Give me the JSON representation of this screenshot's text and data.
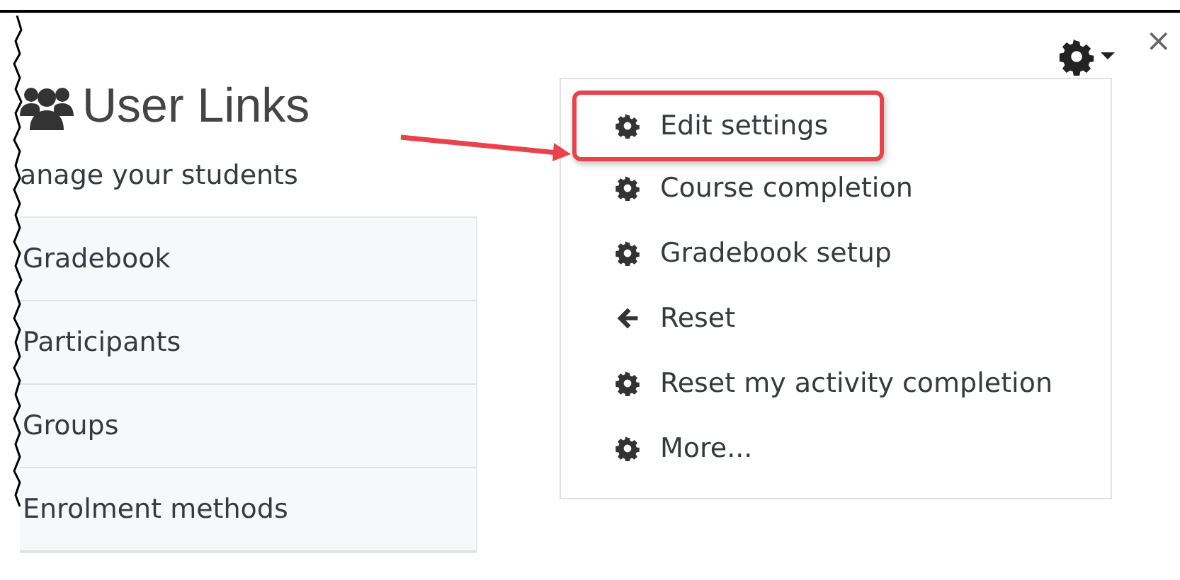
{
  "header": {
    "title": "User Links",
    "subtitle": "anage your students"
  },
  "close": "×",
  "links": [
    {
      "label": "Gradebook"
    },
    {
      "label": "Participants"
    },
    {
      "label": "Groups"
    },
    {
      "label": "Enrolment methods"
    }
  ],
  "menu": [
    {
      "label": "Edit settings",
      "kind": "gear",
      "highlighted": true
    },
    {
      "label": "Course completion",
      "kind": "gear",
      "highlighted": false
    },
    {
      "label": "Gradebook setup",
      "kind": "gear",
      "highlighted": false
    },
    {
      "label": "Reset",
      "kind": "back",
      "highlighted": false
    },
    {
      "label": "Reset my activity completion",
      "kind": "gear",
      "highlighted": false
    },
    {
      "label": "More...",
      "kind": "gear",
      "highlighted": false
    }
  ]
}
